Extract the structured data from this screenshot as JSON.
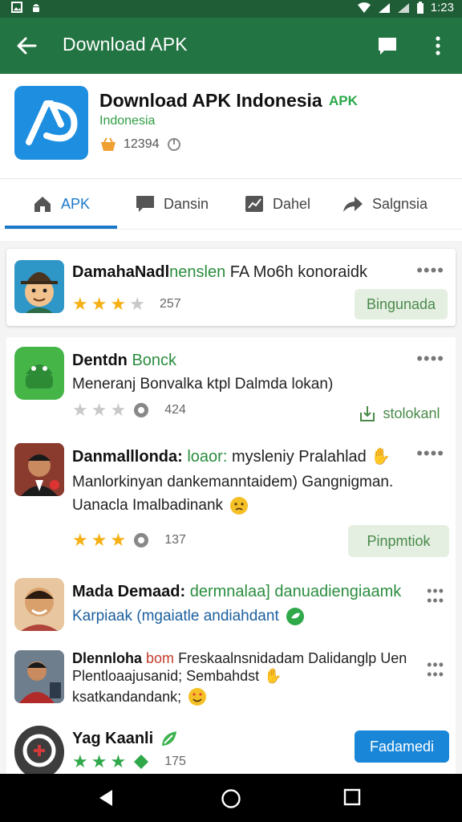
{
  "status": {
    "time": "1:23",
    "icons": [
      "image-icon",
      "android-icon",
      "wifi-icon",
      "signal-icon",
      "battery-icon"
    ]
  },
  "appbar": {
    "title": "Download APK"
  },
  "app": {
    "title": "Download APK Indonesia",
    "badge": "APK",
    "subtitle": "Indonesia",
    "count": "12394"
  },
  "tabs": [
    {
      "label": "APK"
    },
    {
      "label": "Dansin"
    },
    {
      "label": "Dahel"
    },
    {
      "label": "Salgnsia"
    }
  ],
  "items": [
    {
      "name_bold": "DamahaNadl",
      "name_green": "nenslen",
      "name_rest": "FA Mo6h konoraidk",
      "rating": 3,
      "count": "257",
      "button": "Bingunada"
    },
    {
      "name_bold": "Dentdn",
      "name_green": "Bonck",
      "desc": "Meneranj Bonvalka ktpl Dalmda lokan)",
      "rating": 3,
      "count": "424",
      "button": "stolokanl"
    },
    {
      "name_bold": "Danmalllonda:",
      "name_green": "loaor:",
      "name_rest": "mysleniy Pralahlad",
      "desc": "Manlorkinyan dankemanntaidem) Gangnigman.",
      "desc_b": "Uanacla Imalbadinank",
      "rating": 3,
      "count": "137",
      "button": "Pinpmtiok"
    },
    {
      "name_bold": "Mada Demaad:",
      "name_green": "dermnalaa] danuadiengiaamk",
      "desc": "Karpiaak (mgaiatle andiahdant"
    },
    {
      "name_bold": "Dlennloha",
      "name_red": "bom",
      "name_rest": "Freskaalnsnidadam Dalidanglp Uen",
      "desc": "Plentloaajusanid; Sembahdst",
      "desc_b": "ksatkandandank;"
    },
    {
      "name_bold": "Yag Kaanli",
      "rating": 3,
      "count": "175",
      "button": "Fadamedi"
    }
  ],
  "colors": {
    "appbar": "#237443",
    "accent_blue": "#1a78c8",
    "star": "#f5b014",
    "green_text": "#2a8d3e"
  }
}
